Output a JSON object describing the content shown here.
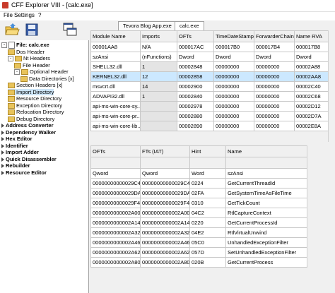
{
  "window": {
    "title": "CFF Explorer VIII - [calc.exe]"
  },
  "menu": [
    "File",
    "Settings",
    "?"
  ],
  "tabs": [
    "Tevora Blog App.exe",
    "calc.exe"
  ],
  "tree": [
    {
      "label": "File: calc.exe",
      "level": 0,
      "icon": "file-icon",
      "expander": "-",
      "bold": true
    },
    {
      "label": "Dos Header",
      "level": 1,
      "icon": "folder-icon"
    },
    {
      "label": "Nt Headers",
      "level": 1,
      "icon": "folder-icon",
      "expander": "-"
    },
    {
      "label": "File Header",
      "level": 2,
      "icon": "folder-icon"
    },
    {
      "label": "Optional Header",
      "level": 2,
      "icon": "folder-icon",
      "expander": "-"
    },
    {
      "label": "Data Directories [x]",
      "level": 3,
      "icon": "folder-icon"
    },
    {
      "label": "Section Headers [x]",
      "level": 1,
      "icon": "folder-icon"
    },
    {
      "label": "Import Directory",
      "level": 1,
      "icon": "folder-icon",
      "selected": true
    },
    {
      "label": "Resource Directory",
      "level": 1,
      "icon": "folder-icon"
    },
    {
      "label": "Exception Directory",
      "level": 1,
      "icon": "folder-icon"
    },
    {
      "label": "Relocation Directory",
      "level": 1,
      "icon": "folder-icon"
    },
    {
      "label": "Debug Directory",
      "level": 1,
      "icon": "folder-icon"
    },
    {
      "label": "Address Converter",
      "level": 0,
      "icon": "arrow-icon",
      "bold": true
    },
    {
      "label": "Dependency Walker",
      "level": 0,
      "icon": "arrow-icon",
      "bold": true
    },
    {
      "label": "Hex Editor",
      "level": 0,
      "icon": "arrow-icon",
      "bold": true
    },
    {
      "label": "Identifier",
      "level": 0,
      "icon": "arrow-icon",
      "bold": true
    },
    {
      "label": "Import Adder",
      "level": 0,
      "icon": "arrow-icon",
      "bold": true
    },
    {
      "label": "Quick Disassembler",
      "level": 0,
      "icon": "arrow-icon",
      "bold": true
    },
    {
      "label": "Rebuilder",
      "level": 0,
      "icon": "arrow-icon",
      "bold": true
    },
    {
      "label": "Resource Editor",
      "level": 0,
      "icon": "arrow-icon",
      "bold": true
    }
  ],
  "upper_table": {
    "headers": [
      "Module Name",
      "Imports",
      "OFTs",
      "TimeDateStamp",
      "ForwarderChain",
      "Name RVA"
    ],
    "rows": [
      [
        "00001AA8",
        "N/A",
        "000017AC",
        "000017B0",
        "000017B4",
        "000017B8"
      ],
      [
        "szAnsi",
        "(nFunctions)",
        "Dword",
        "Dword",
        "Dword",
        "Dword"
      ],
      [
        "SHELL32.dll",
        "1",
        "00002848",
        "00000000",
        "00000000",
        "00002A88"
      ],
      [
        "KERNEL32.dll",
        "12",
        "00002858",
        "00000000",
        "00000000",
        "00002AA8"
      ],
      [
        "msvcrt.dll",
        "14",
        "00002900",
        "00000000",
        "00000000",
        "00002C40"
      ],
      [
        "ADVAPI32.dll",
        "1",
        "00002840",
        "00000000",
        "00000000",
        "00002C68"
      ],
      [
        "api-ms-win-core-sy...",
        "",
        "00002978",
        "00000000",
        "00000000",
        "00002D12"
      ],
      [
        "api-ms-win-core-pr...",
        "",
        "00002880",
        "00000000",
        "00000000",
        "00002D7A"
      ],
      [
        "api-ms-win-core-lib...",
        "",
        "00002890",
        "00000000",
        "00000000",
        "00002E8A"
      ]
    ],
    "selected_row": 3,
    "gray_col_rows": [
      0,
      1,
      2,
      3,
      4,
      5,
      6,
      7,
      8
    ]
  },
  "lower_table": {
    "headers": [
      "OFTs",
      "FTs (IAT)",
      "Hint",
      "Name"
    ],
    "rows": [
      [
        "",
        "",
        "",
        ""
      ],
      [
        "Qword",
        "Qword",
        "Word",
        "szAnsi"
      ],
      [
        "00000000000029C4",
        "00000000000029C4",
        "0224",
        "GetCurrentThreadId"
      ],
      [
        "00000000000029DA",
        "00000000000029DA",
        "02FA",
        "GetSystemTimeAsFileTime"
      ],
      [
        "00000000000029F4",
        "00000000000029F4",
        "0310",
        "GetTickCount"
      ],
      [
        "0000000000002A00",
        "0000000000002A00",
        "04C2",
        "RtlCaptureContext"
      ],
      [
        "0000000000002A14",
        "0000000000002A14",
        "0220",
        "GetCurrentProcessId"
      ],
      [
        "0000000000002A32",
        "0000000000002A32",
        "04E2",
        "RtlVirtualUnwind"
      ],
      [
        "0000000000002A46",
        "0000000000002A46",
        "05C0",
        "UnhandledExceptionFilter"
      ],
      [
        "0000000000002A62",
        "0000000000002A62",
        "057D",
        "SetUnhandledExceptionFilter"
      ],
      [
        "0000000000002A80",
        "0000000000002A80",
        "020B",
        "GetCurrentProcess"
      ]
    ]
  }
}
